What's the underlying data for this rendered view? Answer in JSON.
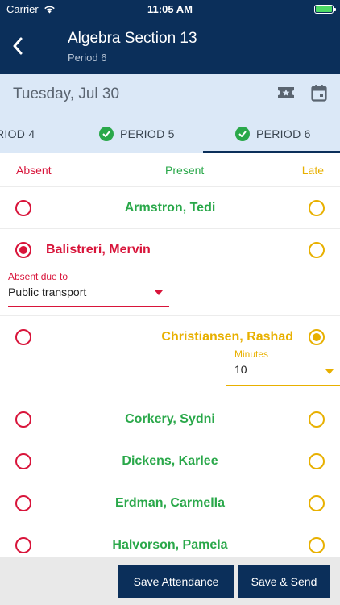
{
  "status": {
    "carrier": "Carrier",
    "time": "11:05 AM"
  },
  "header": {
    "title": "Algebra Section 13",
    "subtitle": "Period 6"
  },
  "date": "Tuesday, Jul 30",
  "tabs": [
    {
      "label": "RIOD 4"
    },
    {
      "label": "PERIOD 5"
    },
    {
      "label": "PERIOD 6"
    }
  ],
  "columns": {
    "absent": "Absent",
    "present": "Present",
    "late": "Late"
  },
  "students": [
    {
      "name": "Armstron, Tedi",
      "status": "present"
    },
    {
      "name": "Balistreri, Mervin",
      "status": "absent"
    },
    {
      "name": "Christiansen, Rashad",
      "status": "late"
    },
    {
      "name": "Corkery, Sydni",
      "status": "present"
    },
    {
      "name": "Dickens, Karlee",
      "status": "present"
    },
    {
      "name": "Erdman, Carmella",
      "status": "present"
    },
    {
      "name": "Halvorson, Pamela",
      "status": "present"
    }
  ],
  "absent_detail": {
    "label": "Absent due to",
    "value": "Public transport"
  },
  "late_detail": {
    "label": "Minutes",
    "value": "10"
  },
  "buttons": {
    "save": "Save Attendance",
    "save_send": "Save & Send"
  },
  "colors": {
    "navy": "#0b2f5a",
    "absent": "#d8143a",
    "present": "#2aa84a",
    "late": "#e8b000"
  }
}
